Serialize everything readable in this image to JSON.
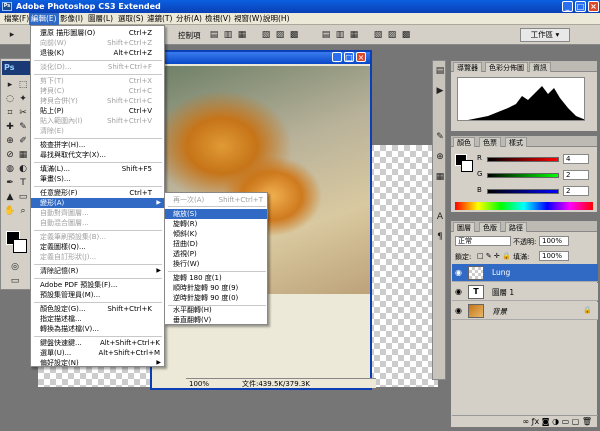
{
  "window": {
    "title": "Adobe Photoshop CS3 Extended",
    "min": "_",
    "max": "□",
    "close": "×"
  },
  "menubar": [
    "檔案(F)",
    "編輯(E)",
    "影像(I)",
    "圖層(L)",
    "選取(S)",
    "濾鏡(T)",
    "分析(A)",
    "檢視(V)",
    "視窗(W)",
    "說明(H)"
  ],
  "optbar": {
    "auto_select_label": "自動選取",
    "workspace": "工作區 ▾",
    "align_label": "控制項"
  },
  "edit_menu": [
    {
      "label": "還原 描形圖層(O)",
      "shortcut": "Ctrl+Z"
    },
    {
      "label": "向前(W)",
      "shortcut": "Shift+Ctrl+Z",
      "disabled": true
    },
    {
      "label": "退後(K)",
      "shortcut": "Alt+Ctrl+Z"
    },
    {
      "label": "淡化(D)...",
      "shortcut": "Shift+Ctrl+F",
      "disabled": true
    },
    {
      "label": "剪下(T)",
      "shortcut": "Ctrl+X",
      "disabled": true
    },
    {
      "label": "拷貝(C)",
      "shortcut": "Ctrl+C",
      "disabled": true
    },
    {
      "label": "拷貝合併(Y)",
      "shortcut": "Shift+Ctrl+C",
      "disabled": true
    },
    {
      "label": "貼上(P)",
      "shortcut": "Ctrl+V"
    },
    {
      "label": "貼入範圍內(I)",
      "shortcut": "Shift+Ctrl+V",
      "disabled": true
    },
    {
      "label": "清除(E)",
      "shortcut": "",
      "disabled": true
    },
    {
      "label": "檢查拼字(H)...",
      "shortcut": ""
    },
    {
      "label": "尋找與取代文字(X)...",
      "shortcut": ""
    },
    {
      "label": "填滿(L)...",
      "shortcut": "Shift+F5"
    },
    {
      "label": "筆畫(S)...",
      "shortcut": ""
    },
    {
      "label": "任意變形(F)",
      "shortcut": "Ctrl+T"
    },
    {
      "label": "變形(A)",
      "shortcut": ""
    },
    {
      "label": "自動對齊圖層...",
      "shortcut": "",
      "disabled": true
    },
    {
      "label": "自動混合圖層...",
      "shortcut": "",
      "disabled": true
    },
    {
      "label": "定義筆刷預設集(B)...",
      "shortcut": "",
      "disabled": true
    },
    {
      "label": "定義圖樣(Q)...",
      "shortcut": ""
    },
    {
      "label": "定義自訂形狀(J)...",
      "shortcut": "",
      "disabled": true
    },
    {
      "label": "清除記憶(R)",
      "shortcut": ""
    },
    {
      "label": "Adobe PDF 預設集(F)...",
      "shortcut": ""
    },
    {
      "label": "預設集管理員(M)...",
      "shortcut": ""
    },
    {
      "label": "顏色設定(G)...",
      "shortcut": "Shift+Ctrl+K"
    },
    {
      "label": "指定描述檔...",
      "shortcut": ""
    },
    {
      "label": "轉換為描述檔(V)...",
      "shortcut": ""
    },
    {
      "label": "鍵盤快速鍵...",
      "shortcut": "Alt+Shift+Ctrl+K"
    },
    {
      "label": "選單(U)...",
      "shortcut": "Alt+Shift+Ctrl+M"
    },
    {
      "label": "偏好設定(N)",
      "shortcut": ""
    }
  ],
  "transform_menu": [
    {
      "label": "再一次(A)",
      "shortcut": "Shift+Ctrl+T",
      "disabled": true
    },
    {
      "label": "縮放(S)",
      "shortcut": ""
    },
    {
      "label": "旋轉(R)",
      "shortcut": ""
    },
    {
      "label": "傾斜(K)",
      "shortcut": ""
    },
    {
      "label": "扭曲(D)",
      "shortcut": ""
    },
    {
      "label": "透視(P)",
      "shortcut": ""
    },
    {
      "label": "換行(W)",
      "shortcut": ""
    },
    {
      "label": "旋轉 180 度(1)",
      "shortcut": ""
    },
    {
      "label": "順時針旋轉 90 度(9)",
      "shortcut": ""
    },
    {
      "label": "逆時針旋轉 90 度(0)",
      "shortcut": ""
    },
    {
      "label": "水平翻轉(H)",
      "shortcut": ""
    },
    {
      "label": "垂直翻轉(V)",
      "shortcut": ""
    }
  ],
  "document": {
    "zoom": "100%",
    "info": "文件:439.5K/379.3K"
  },
  "panels": {
    "nav_tabs": [
      "導覽器",
      "色彩分佈圖",
      "資訊"
    ],
    "color_tabs": [
      "顏色",
      "色票",
      "樣式"
    ],
    "color": {
      "r": "4",
      "g": "2",
      "b": "2"
    },
    "layer_tabs": [
      "圖層",
      "色版",
      "路徑"
    ],
    "blend_mode": "正常",
    "opacity_label": "不透明:",
    "opacity": "100%",
    "lock_label": "鎖定:",
    "fill_label": "填滿:",
    "fill": "100%",
    "layers": [
      {
        "name": "Lung",
        "thumb": "",
        "active": true,
        "lock": ""
      },
      {
        "name": "圖層 1",
        "thumb": "T",
        "active": false,
        "lock": ""
      },
      {
        "name": "背景",
        "thumb": "",
        "active": false,
        "lock": "🔒"
      }
    ]
  },
  "tools": [
    "▸",
    "⬚",
    "◌",
    "✂",
    "⌗",
    "✎",
    "⊘",
    "✦",
    "◐",
    "△",
    "▲",
    "T",
    "✋",
    "⌕"
  ],
  "colors": {
    "accent": "#316ac5",
    "title": "#0a48c8"
  }
}
